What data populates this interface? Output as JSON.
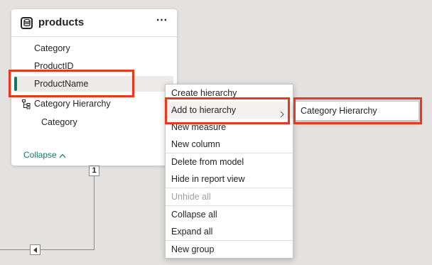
{
  "table_card": {
    "title": "products",
    "more_label": "⋯",
    "icon": "table-icon",
    "fields": [
      {
        "label": "Category"
      },
      {
        "label": "ProductID"
      },
      {
        "label": "ProductName",
        "selected": true
      },
      {
        "label": "Category Hierarchy",
        "icon": "hierarchy-icon"
      },
      {
        "label": "Category",
        "level": 1
      }
    ],
    "collapse_label": "Collapse"
  },
  "relationship": {
    "cardinality": "1"
  },
  "context_menu": {
    "items": [
      {
        "label": "Create hierarchy"
      },
      {
        "label": "Add to hierarchy",
        "has_submenu": true,
        "highlighted": true
      },
      {
        "label": "New measure"
      },
      {
        "label": "New column"
      },
      {
        "label": "Delete from model"
      },
      {
        "label": "Hide in report view"
      },
      {
        "label": "Unhide all",
        "disabled": true
      },
      {
        "label": "Collapse all"
      },
      {
        "label": "Expand all"
      },
      {
        "label": "New group"
      }
    ]
  },
  "submenu": {
    "items": [
      {
        "label": "Category Hierarchy"
      }
    ]
  },
  "colors": {
    "accent": "#117865",
    "annotation": "#e8391d",
    "canvas": "#e4e2e0"
  }
}
